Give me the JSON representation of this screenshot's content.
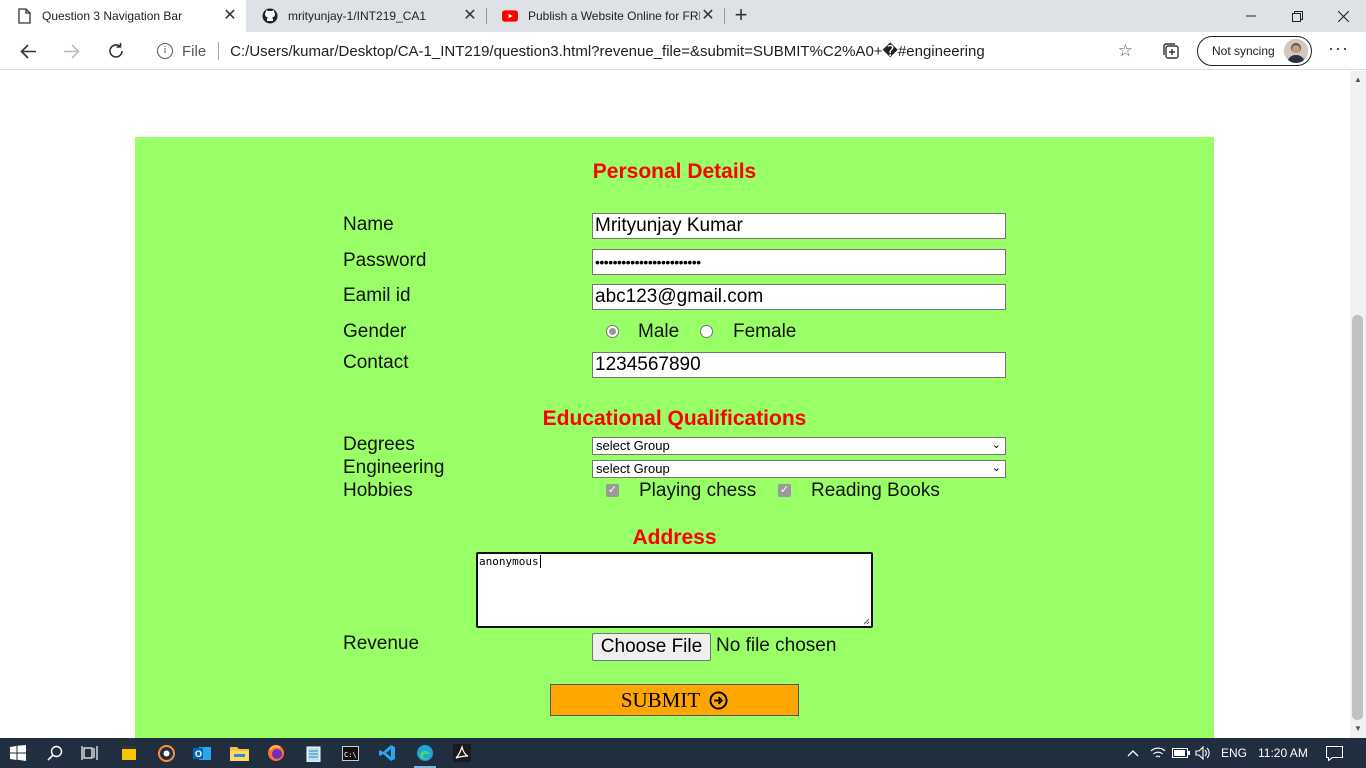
{
  "browser": {
    "tabs": [
      {
        "label": "Question 3 Navigation Bar",
        "icon": "page-icon",
        "active": true
      },
      {
        "label": "mrityunjay-1/INT219_CA1",
        "icon": "github-icon",
        "active": false
      },
      {
        "label": "Publish a Website Online for FREE",
        "icon": "youtube-icon",
        "active": false
      }
    ],
    "address": {
      "scheme_label": "File",
      "url": "C:/Users/kumar/Desktop/CA-1_INT219/question3.html?revenue_file=&submit=SUBMIT%C2%A0+�#engineering"
    },
    "profile": {
      "sync_label": "Not syncing"
    }
  },
  "form": {
    "personal_heading": "Personal Details",
    "name_label": "Name",
    "name_value": "Mrityunjay Kumar",
    "password_label": "Password",
    "password_value": "••••••••••••••••••••••••",
    "email_label": "Eamil id",
    "email_value": "abc123@gmail.com",
    "gender_label": "Gender",
    "gender_options": [
      "Male",
      "Female"
    ],
    "gender_selected": "Male",
    "contact_label": "Contact",
    "contact_value": "1234567890",
    "edu_heading": "Educational Qualifications",
    "degrees_label": "Degrees",
    "degrees_value": "select Group",
    "engineering_label": "Engineering",
    "engineering_value": "select Group",
    "hobbies_label": "Hobbies",
    "hobbies": [
      {
        "label": "Playing chess",
        "checked": true
      },
      {
        "label": "Reading Books",
        "checked": true
      }
    ],
    "address_heading": "Address",
    "address_value": "anonymous",
    "revenue_label": "Revenue",
    "file_button": "Choose File",
    "file_status": "No file chosen",
    "submit_label": "SUBMIT"
  },
  "taskbar": {
    "language": "ENG",
    "time": "11:20 AM"
  },
  "colors": {
    "panel_bg": "#99ff66",
    "heading": "#ff0000",
    "submit_bg": "#ffa500",
    "taskbar": "#202e3f"
  }
}
